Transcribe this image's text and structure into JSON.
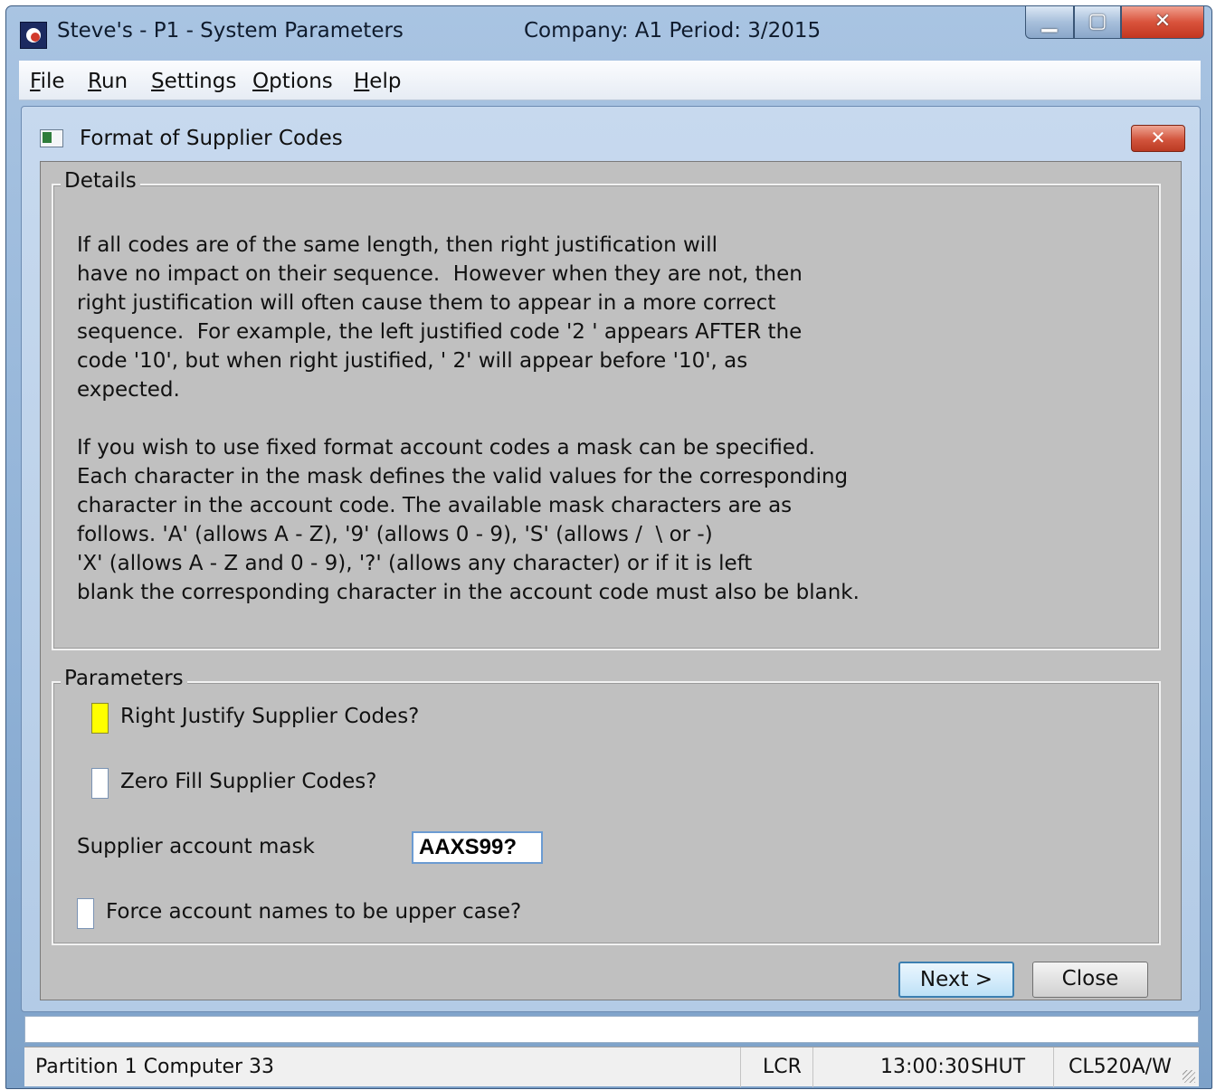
{
  "window": {
    "title": "Steve's - P1 - System Parameters",
    "company_period": "Company: A1  Period:  3/2015",
    "controls": {
      "minimize": "▁",
      "maximize": "▢",
      "close": "✕"
    }
  },
  "menu": {
    "items": [
      {
        "mnemonic": "F",
        "rest": "ile"
      },
      {
        "mnemonic": "R",
        "rest": "un"
      },
      {
        "mnemonic": "S",
        "rest": "ettings"
      },
      {
        "mnemonic": "O",
        "rest": "ptions"
      },
      {
        "mnemonic": "H",
        "rest": "elp"
      }
    ]
  },
  "dialog": {
    "title": "Format of Supplier Codes",
    "close_glyph": "✕",
    "details": {
      "legend": "Details",
      "paragraph_1": [
        "If all codes are of the same length, then right justification will",
        "have no impact on their sequence.  However when they are not, then",
        "right justification will often cause them to appear in a more correct",
        "sequence.  For example, the left justified code '2 ' appears AFTER the",
        "code '10', but when right justified, ' 2' will appear before '10', as",
        "expected."
      ],
      "paragraph_2": [
        "If you wish to use fixed format account codes a mask can be specified.",
        "Each character in the mask defines the valid values for the corresponding",
        "character in the account code. The available mask characters are as",
        "follows. 'A' (allows A - Z), '9' (allows 0 - 9), 'S' (allows /  \\ or -)",
        "'X' (allows A - Z and 0 - 9), '?' (allows any character) or if it is left",
        "blank the corresponding character in the account code must also be blank."
      ]
    },
    "parameters": {
      "legend": "Parameters",
      "right_justify_label": "Right Justify Supplier Codes?",
      "zero_fill_label": "Zero Fill Supplier Codes?",
      "mask_label": "Supplier account mask",
      "mask_value": "AAXS99?",
      "upper_case_label": "Force account names to be upper case?"
    },
    "buttons": {
      "next": "Next >",
      "close": "Close"
    }
  },
  "statusbar": {
    "partition": "Partition 1 Computer 33",
    "mode": "LCR",
    "time": "13:00:30",
    "state": "SHUT",
    "program": "CL520A/W"
  }
}
